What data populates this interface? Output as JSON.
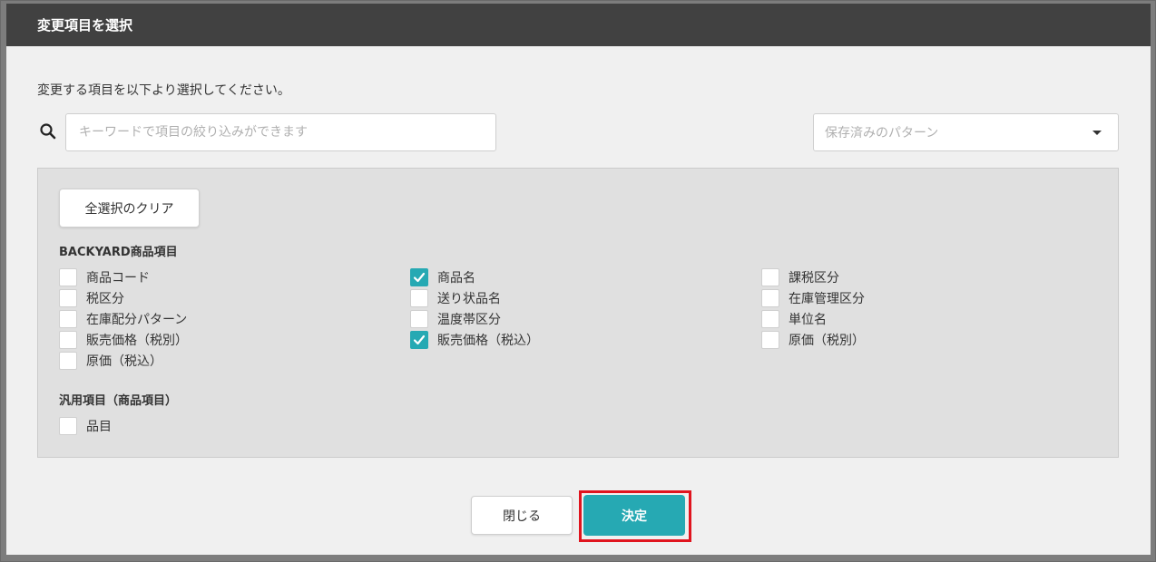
{
  "dialog": {
    "title": "変更項目を選択",
    "instruction": "変更する項目を以下より選択してください。"
  },
  "search": {
    "placeholder": "キーワードで項目の絞り込みができます",
    "value": ""
  },
  "pattern_select": {
    "placeholder": "保存済みのパターン"
  },
  "clear_button_label": "全選択のクリア",
  "groups": [
    {
      "title": "BACKYARD商品項目",
      "columns": [
        [
          {
            "label": "商品コード",
            "checked": false
          },
          {
            "label": "税区分",
            "checked": false
          },
          {
            "label": "在庫配分パターン",
            "checked": false
          },
          {
            "label": "販売価格（税別）",
            "checked": false
          },
          {
            "label": "原価（税込）",
            "checked": false
          }
        ],
        [
          {
            "label": "商品名",
            "checked": true
          },
          {
            "label": "送り状品名",
            "checked": false
          },
          {
            "label": "温度帯区分",
            "checked": false
          },
          {
            "label": "販売価格（税込）",
            "checked": true
          }
        ],
        [
          {
            "label": "課税区分",
            "checked": false
          },
          {
            "label": "在庫管理区分",
            "checked": false
          },
          {
            "label": "単位名",
            "checked": false
          },
          {
            "label": "原価（税別）",
            "checked": false
          }
        ]
      ]
    },
    {
      "title": "汎用項目（商品項目）",
      "columns": [
        [
          {
            "label": "品目",
            "checked": false
          }
        ]
      ]
    }
  ],
  "footer": {
    "close_label": "閉じる",
    "confirm_label": "決定"
  },
  "colors": {
    "header_bg": "#414141",
    "accent": "#26a9b3",
    "highlight": "#e0141e"
  },
  "icons": {
    "search": "search-icon",
    "dropdown": "caret-down-icon",
    "check": "check-icon"
  }
}
